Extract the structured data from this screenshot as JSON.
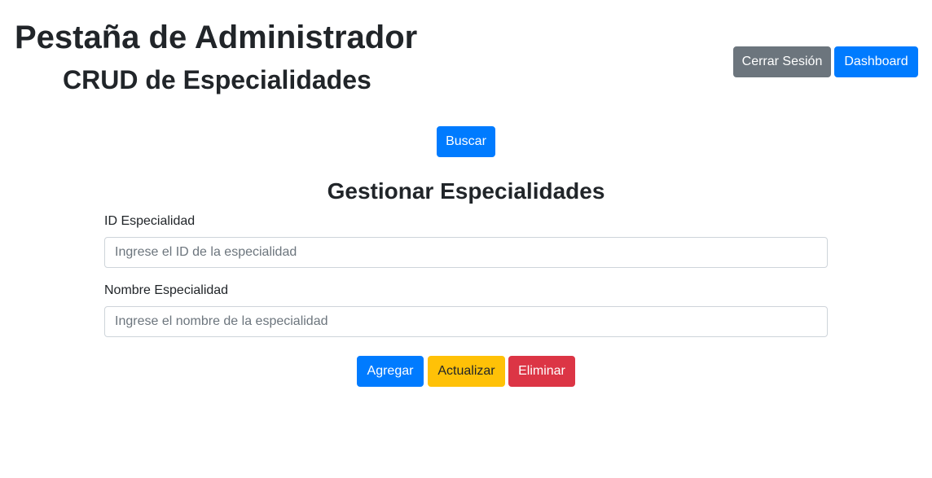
{
  "header": {
    "title": "Pestaña de Administrador",
    "subtitle": "CRUD de Especialidades",
    "logout_label": "Cerrar Sesión",
    "dashboard_label": "Dashboard"
  },
  "search": {
    "button_label": "Buscar"
  },
  "form": {
    "title": "Gestionar Especialidades",
    "id_label": "ID Especialidad",
    "id_placeholder": "Ingrese el ID de la especialidad",
    "id_value": "",
    "name_label": "Nombre Especialidad",
    "name_placeholder": "Ingrese el nombre de la especialidad",
    "name_value": ""
  },
  "actions": {
    "add_label": "Agregar",
    "update_label": "Actualizar",
    "delete_label": "Eliminar"
  },
  "colors": {
    "primary": "#007bff",
    "secondary": "#6c757d",
    "warning": "#ffc107",
    "danger": "#dc3545"
  }
}
